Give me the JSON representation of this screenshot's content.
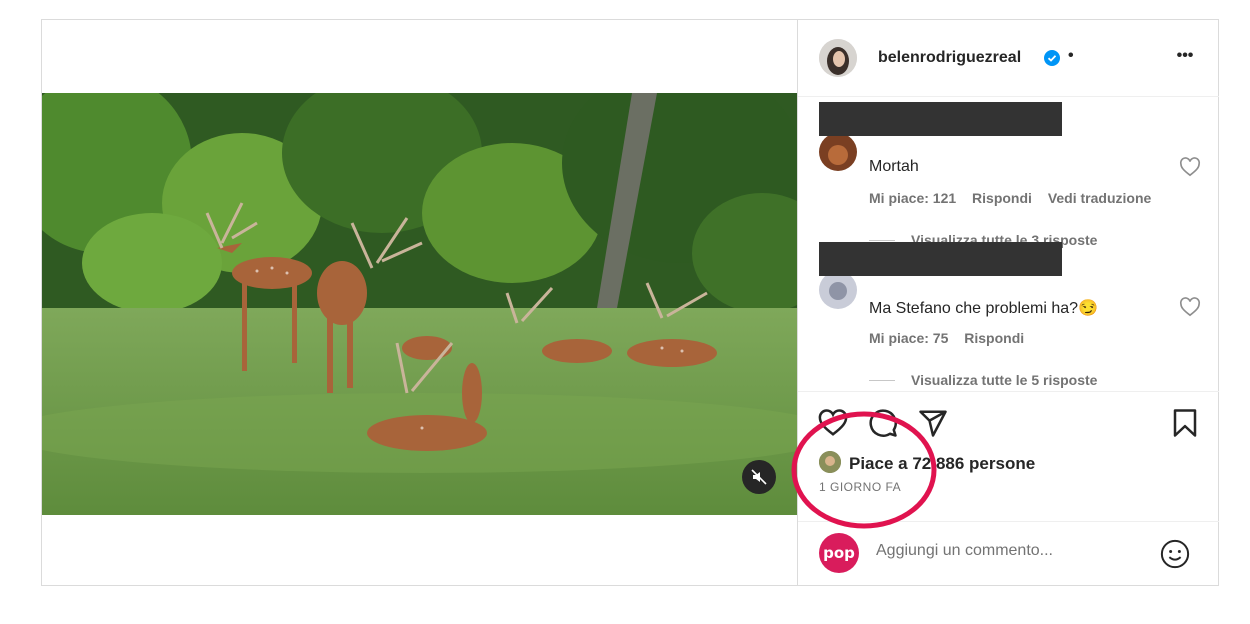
{
  "post": {
    "username": "belenrodriguezreal",
    "separator": "•",
    "more_label": "•••"
  },
  "comments": [
    {
      "text": "Mortah",
      "likes": "Mi piace: 121",
      "reply": "Rispondi",
      "translate": "Vedi traduzione",
      "view_replies": "Visualizza tutte le 3 risposte"
    },
    {
      "text": "Ma Stefano che problemi ha?😏",
      "likes": "Mi piace: 75",
      "reply": "Rispondi",
      "view_replies": "Visualizza tutte le 5 risposte"
    }
  ],
  "likes_text": "Piace a 72.886 persone",
  "date": "1 GIORNO FA",
  "composer": {
    "avatar_text": "pop",
    "placeholder": "Aggiungi un commento..."
  },
  "icons": [
    "heart-icon",
    "comment-icon",
    "share-icon",
    "bookmark-icon",
    "mute-icon",
    "verified-icon",
    "more-icon",
    "emoji-icon"
  ],
  "colors": {
    "verified": "#0095f6",
    "annotation": "#e0134f",
    "pop_brand": "#d91c5c"
  }
}
